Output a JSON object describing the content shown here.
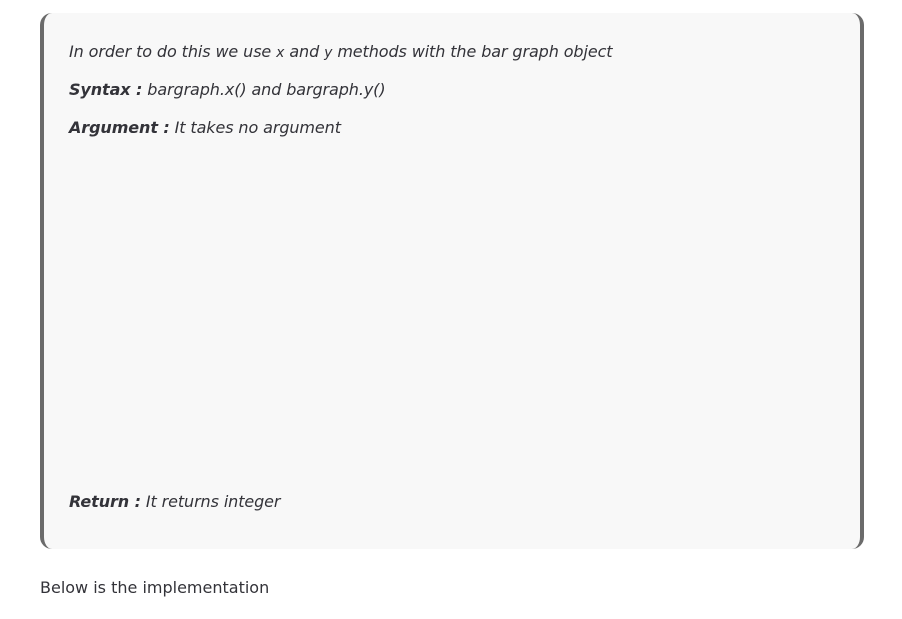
{
  "note": {
    "intro_part1": "In order to do this we use ",
    "intro_var_x": "x",
    "intro_part2": " and ",
    "intro_var_y": "y",
    "intro_part3": " methods with the bar graph object",
    "syntax_label": "Syntax :",
    "syntax_text": " bargraph.x() and bargraph.y()",
    "argument_label": "Argument :",
    "argument_text": " It takes no argument",
    "return_label": "Return :",
    "return_text": " It returns integer"
  },
  "body": {
    "implementation_text": "Below is the implementation"
  }
}
